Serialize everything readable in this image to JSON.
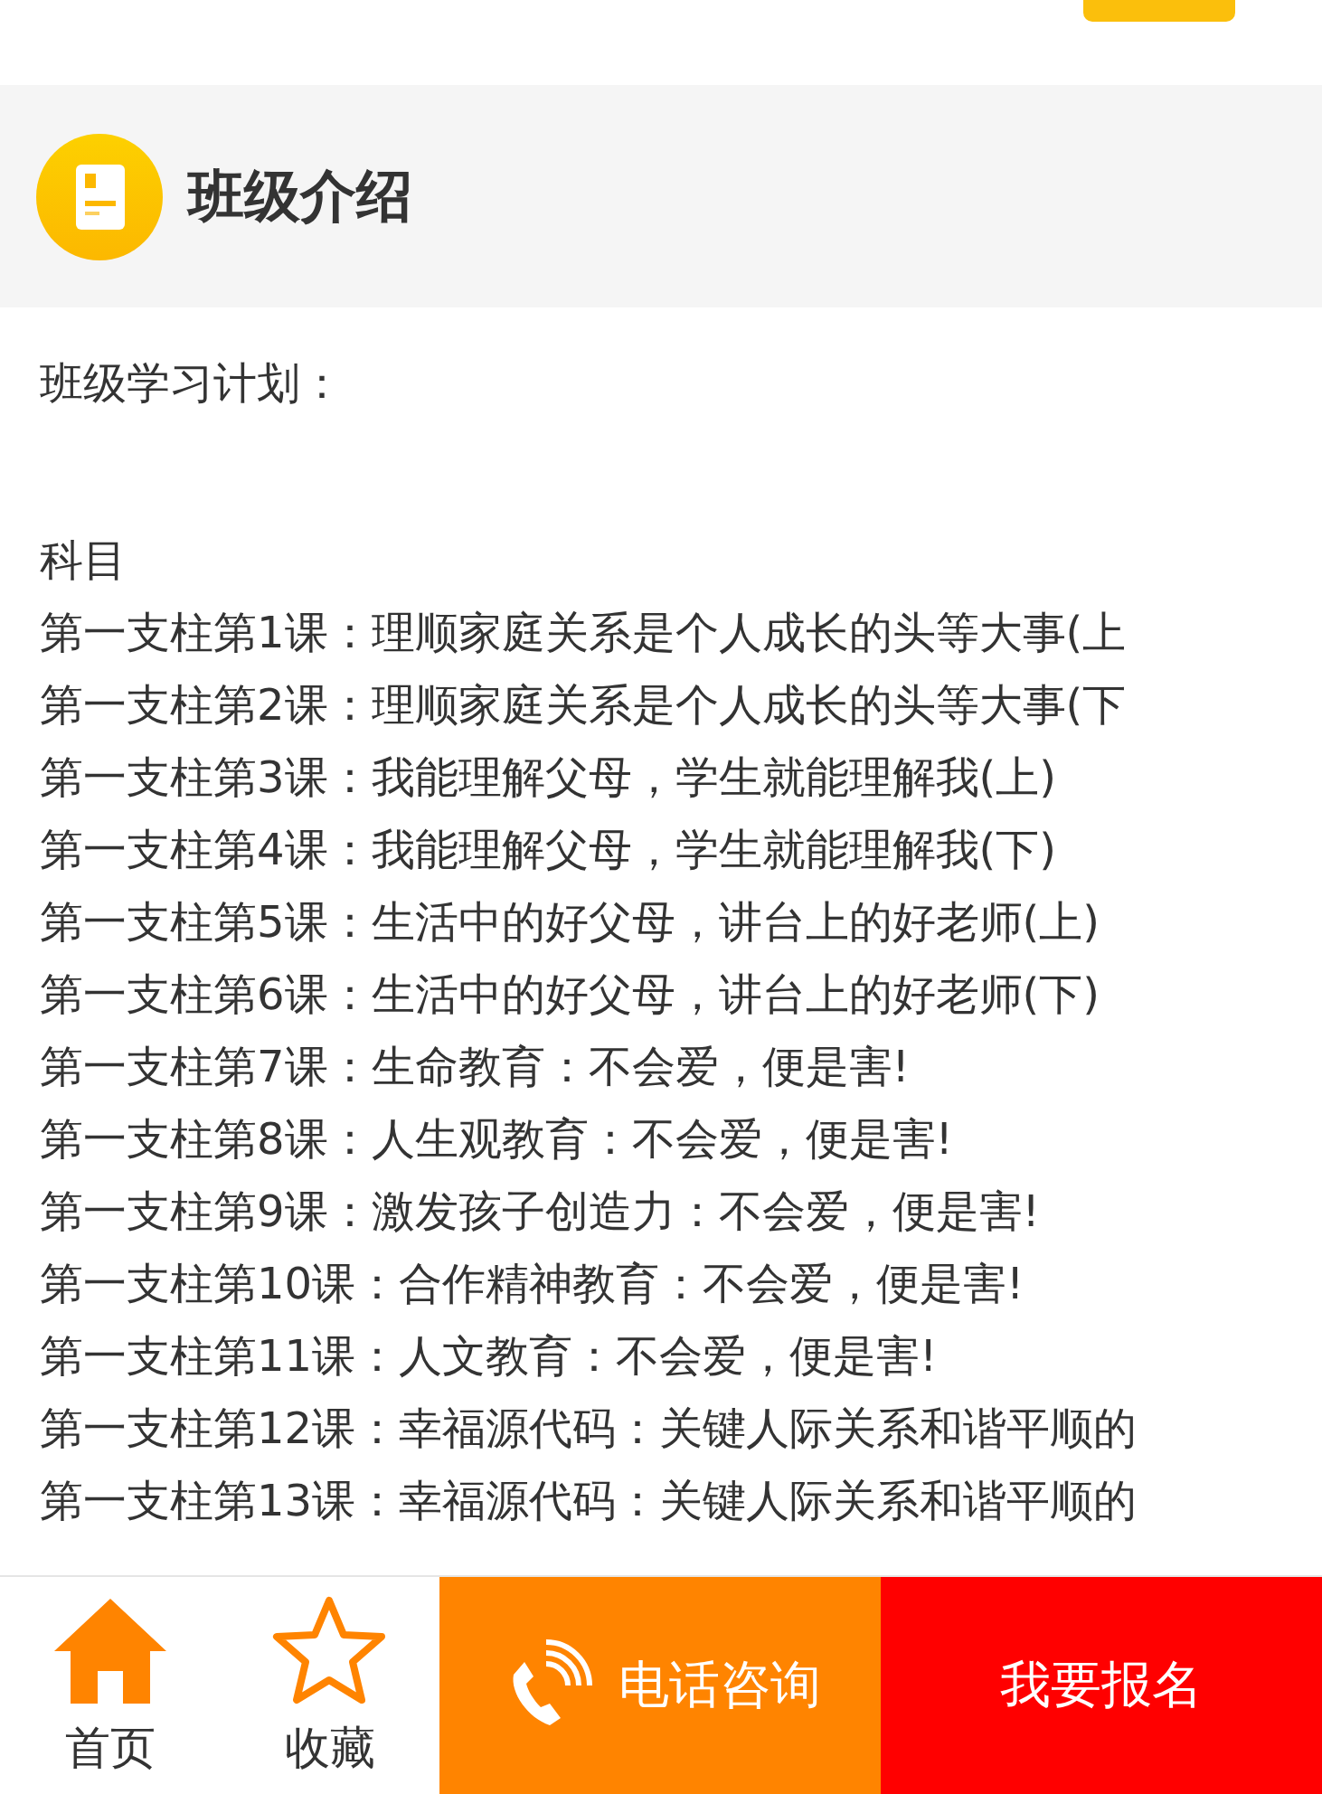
{
  "section": {
    "title": "班级介绍"
  },
  "content": {
    "heading": "班级学习计划：",
    "subject_label": "科目",
    "lessons": [
      "第一支柱第1课：理顺家庭关系是个人成长的头等大事(上",
      "第一支柱第2课：理顺家庭关系是个人成长的头等大事(下",
      "第一支柱第3课：我能理解父母，学生就能理解我(上)",
      "第一支柱第4课：我能理解父母，学生就能理解我(下)",
      "第一支柱第5课：生活中的好父母，讲台上的好老师(上)",
      "第一支柱第6课：生活中的好父母，讲台上的好老师(下)",
      "第一支柱第7课：生命教育：不会爱，便是害!",
      "第一支柱第8课：人生观教育：不会爱，便是害!",
      "第一支柱第9课：激发孩子创造力：不会爱，便是害!",
      "第一支柱第10课：合作精神教育：不会爱，便是害!",
      "第一支柱第11课：人文教育：不会爱，便是害!",
      "第一支柱第12课：幸福源代码：关键人际关系和谐平顺的",
      "第一支柱第13课：幸福源代码：关键人际关系和谐平顺的"
    ]
  },
  "bottom_bar": {
    "nav": [
      {
        "label": "首页",
        "kind": "home"
      },
      {
        "label": "收藏",
        "kind": "star"
      }
    ],
    "consult_button": "电话咨询",
    "signup_button": "我要报名"
  }
}
